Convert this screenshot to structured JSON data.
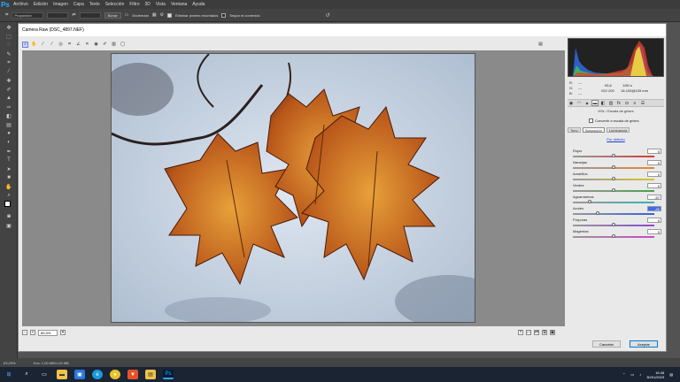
{
  "menubar": {
    "logo": "Ps",
    "items": [
      "Archivo",
      "Edición",
      "Imagen",
      "Capa",
      "Texto",
      "Selección",
      "Filtro",
      "3D",
      "Vista",
      "Ventana",
      "Ayuda"
    ]
  },
  "options": {
    "mode_value": "Proporción",
    "clear_label": "Borrar",
    "straighten_label": "Enderezar",
    "delete_cropped_label": "Eliminar píxeles recortados",
    "content_aware_label": "Según el contenido"
  },
  "statusbar": {
    "zoom": "63,29%",
    "doc": "Doc: 1,00 MB/1,00 MB"
  },
  "taskbar": {
    "time": "16:48",
    "date": "30/01/2023"
  },
  "dialog": {
    "title": "Camera Raw (DSC_4897.NEF)",
    "zoom_value": "89,3%",
    "cancel_label": "Cancelar",
    "accept_label": "Aceptar"
  },
  "info": {
    "r_label": "R:",
    "g_label": "G:",
    "b_label": "B:",
    "r_val": "---",
    "g_val": "---",
    "b_val": "---",
    "aperture": "f/5,6",
    "shutter": "1/50 s",
    "iso": "ISO 200",
    "lens": "18-105@105 mm"
  },
  "panel": {
    "title": "HSL / Escala de grises",
    "convert_label": "Convertir a escala de grises",
    "tabs": [
      "Tono",
      "Saturación",
      "Luminancia"
    ],
    "default_label": "Por defecto",
    "sliders": [
      {
        "label": "Rojos",
        "value": "0",
        "pos": 0.5,
        "color": "#d53a3a"
      },
      {
        "label": "Naranjas",
        "value": "0",
        "pos": 0.5,
        "color": "#e08a2e"
      },
      {
        "label": "Amarillos",
        "value": "0",
        "pos": 0.5,
        "color": "#d6c52a"
      },
      {
        "label": "Verdes",
        "value": "0",
        "pos": 0.5,
        "color": "#4aa04a"
      },
      {
        "label": "Aguamarinas",
        "value": "-57",
        "pos": 0.21,
        "color": "#3ab0b0"
      },
      {
        "label": "Azules",
        "value": "-40",
        "pos": 0.3,
        "color": "#3a60d8",
        "selected": true
      },
      {
        "label": "Púrpuras",
        "value": "0",
        "pos": 0.5,
        "color": "#8a4ad0"
      },
      {
        "label": "Magentas",
        "value": "0",
        "pos": 0.5,
        "color": "#c84ac0"
      }
    ]
  },
  "colors": {
    "accent": "#31a8ff",
    "dialog_bg": "#e9e9e9",
    "photo_sky": "#c9d6e6",
    "leaf": "#c5631a"
  }
}
